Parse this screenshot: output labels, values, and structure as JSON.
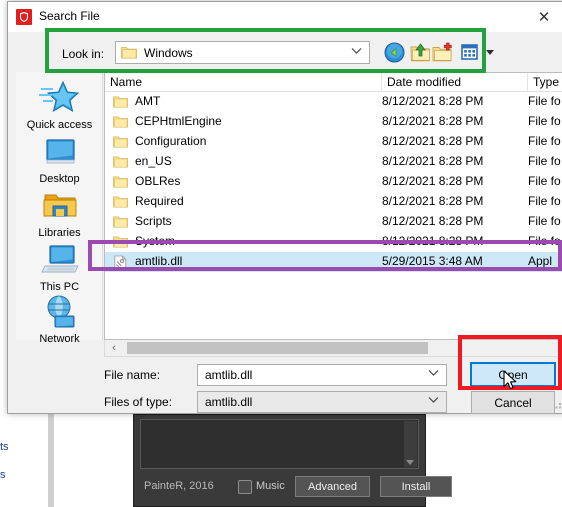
{
  "window": {
    "title": "Search File",
    "icon": "shield-icon",
    "close_label": "✕"
  },
  "lookin": {
    "label": "Look in:",
    "value": "Windows",
    "folder_icon": "folder-icon",
    "chevron": "⌵",
    "toolbar": [
      {
        "name": "back-icon",
        "title": "Back"
      },
      {
        "name": "up-one-level-icon",
        "title": "Up One Level"
      },
      {
        "name": "create-new-folder-icon",
        "title": "Create New Folder"
      },
      {
        "name": "views-icon",
        "title": "Views"
      }
    ]
  },
  "places": [
    {
      "label": "Quick access",
      "icon": "quick-access-star-icon"
    },
    {
      "label": "Desktop",
      "icon": "desktop-monitor-icon"
    },
    {
      "label": "Libraries",
      "icon": "libraries-folder-icon"
    },
    {
      "label": "This PC",
      "icon": "this-pc-computer-icon"
    },
    {
      "label": "Network",
      "icon": "network-globe-icon"
    }
  ],
  "filelist": {
    "columns": [
      "Name",
      "Date modified",
      "Type"
    ],
    "rows": [
      {
        "name": "AMT",
        "date": "8/12/2021 8:28 PM",
        "type": "File fo",
        "icon": "folder-icon",
        "selected": false
      },
      {
        "name": "CEPHtmlEngine",
        "date": "8/12/2021 8:28 PM",
        "type": "File fo",
        "icon": "folder-icon",
        "selected": false
      },
      {
        "name": "Configuration",
        "date": "8/12/2021 8:28 PM",
        "type": "File fo",
        "icon": "folder-icon",
        "selected": false
      },
      {
        "name": "en_US",
        "date": "8/12/2021 8:28 PM",
        "type": "File fo",
        "icon": "folder-icon",
        "selected": false
      },
      {
        "name": "OBLRes",
        "date": "8/12/2021 8:28 PM",
        "type": "File fo",
        "icon": "folder-icon",
        "selected": false
      },
      {
        "name": "Required",
        "date": "8/12/2021 8:28 PM",
        "type": "File fo",
        "icon": "folder-icon",
        "selected": false
      },
      {
        "name": "Scripts",
        "date": "8/12/2021 8:28 PM",
        "type": "File fo",
        "icon": "folder-icon",
        "selected": false
      },
      {
        "name": "System",
        "date": "8/12/2021 8:28 PM",
        "type": "File fo",
        "icon": "folder-icon",
        "selected": false
      },
      {
        "name": "amtlib.dll",
        "date": "5/29/2015 3:48 AM",
        "type": "Appl",
        "icon": "dll-file-icon",
        "selected": true
      }
    ],
    "scroll_left_arrow": "‹",
    "scroll_right_arrow": "›"
  },
  "form": {
    "filename_label": "File name:",
    "filename_value": "amtlib.dll",
    "filetype_label": "Files of type:",
    "filetype_value": "amtlib.dll",
    "chevron": "⌵",
    "open_button": "Open",
    "cancel_button": "Cancel"
  },
  "annotations": [
    {
      "name": "lookin-highlight",
      "color": "#22a23f"
    },
    {
      "name": "selected-file-highlight",
      "color": "#9b4bb0"
    },
    {
      "name": "open-button-highlight",
      "color": "#ef1a21"
    }
  ],
  "background": {
    "installer": {
      "credit": "PainteR, 2016",
      "music_checkbox_label": "Music",
      "advanced_button": "Advanced",
      "install_button": "Install"
    },
    "left_text": [
      "ts",
      "s"
    ]
  }
}
